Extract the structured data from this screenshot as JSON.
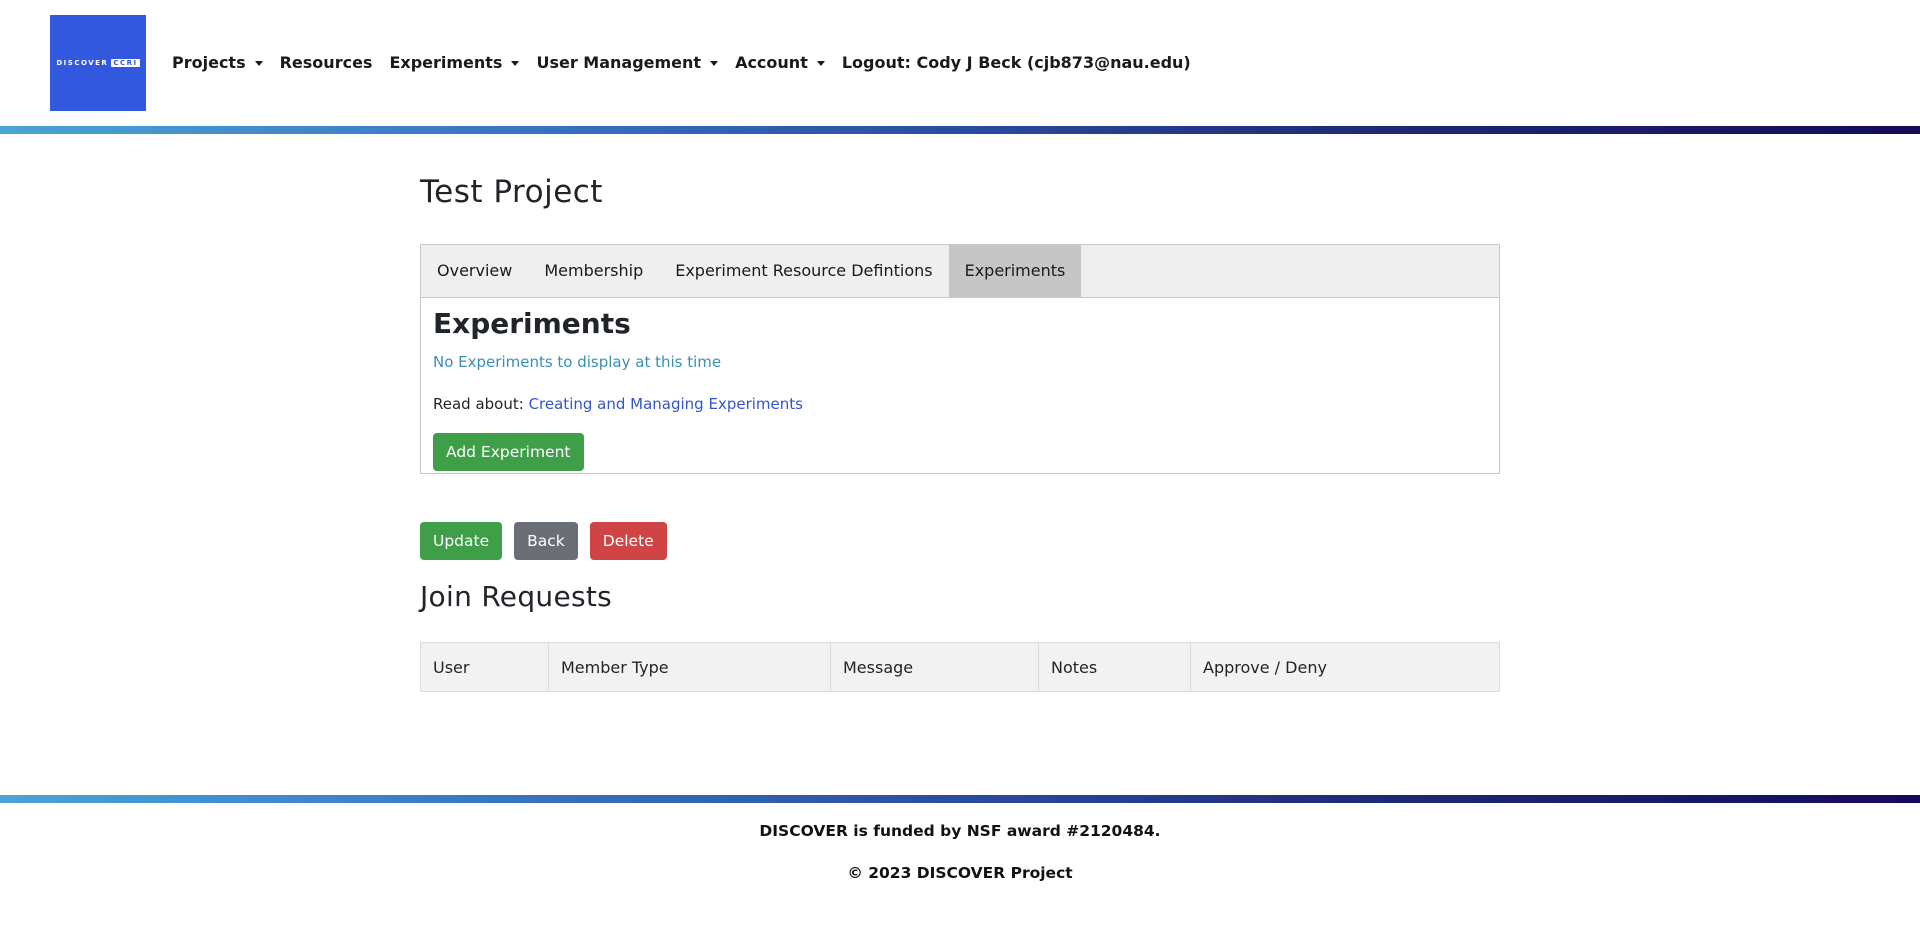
{
  "header": {
    "logo_text": "DISCOVER",
    "logo_badge": "CCRI",
    "nav": [
      {
        "label": "Projects",
        "dropdown": true
      },
      {
        "label": "Resources",
        "dropdown": false
      },
      {
        "label": "Experiments",
        "dropdown": true
      },
      {
        "label": "User Management",
        "dropdown": true
      },
      {
        "label": "Account",
        "dropdown": true
      },
      {
        "label": "Logout: Cody J Beck (cjb873@nau.edu)",
        "dropdown": false
      }
    ]
  },
  "page": {
    "title": "Test Project",
    "tabs": [
      {
        "label": "Overview",
        "active": false
      },
      {
        "label": "Membership",
        "active": false
      },
      {
        "label": "Experiment Resource Defintions",
        "active": false
      },
      {
        "label": "Experiments",
        "active": true
      }
    ],
    "experiments": {
      "heading": "Experiments",
      "empty_message": "No Experiments to display at this time",
      "read_about_prefix": "Read about:",
      "read_about_link": "Creating and Managing Experiments",
      "add_button": "Add Experiment"
    },
    "actions": {
      "update": "Update",
      "back": "Back",
      "delete": "Delete"
    },
    "join_requests": {
      "title": "Join Requests",
      "columns": [
        "User",
        "Member Type",
        "Message",
        "Notes",
        "Approve / Deny"
      ]
    }
  },
  "footer": {
    "funding": "DISCOVER is funded by NSF award #2120484.",
    "copyright": "© 2023 DISCOVER Project"
  },
  "colors": {
    "logo_bg": "#3358e0",
    "success": "#3f9e48",
    "secondary": "#6a6e76",
    "danger": "#cf4545",
    "info_text": "#3a8fb7",
    "link": "#3355cc"
  }
}
